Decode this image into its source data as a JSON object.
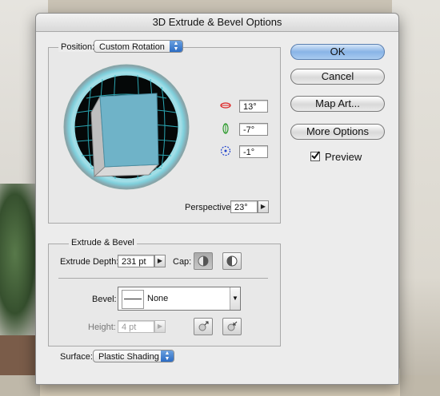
{
  "window": {
    "title": "3D Extrude & Bevel Options"
  },
  "position": {
    "label": "Position:",
    "preset": "Custom Rotation",
    "x_rotation": "13°",
    "y_rotation": "-7°",
    "z_rotation": "-1°",
    "perspective_label": "Perspective:",
    "perspective_value": "23°"
  },
  "extrude_bevel": {
    "group_label": "Extrude & Bevel",
    "depth_label": "Extrude Depth:",
    "depth_value": "231 pt",
    "cap_label": "Cap:",
    "bevel_label": "Bevel:",
    "bevel_value": "None",
    "height_label": "Height:",
    "height_value": "4 pt"
  },
  "surface": {
    "label": "Surface:",
    "value": "Plastic Shading"
  },
  "buttons": {
    "ok": "OK",
    "cancel": "Cancel",
    "map_art": "Map Art...",
    "more_options": "More Options"
  },
  "preview": {
    "label": "Preview",
    "checked": true
  },
  "colors": {
    "cube_face": "#6fb3c8",
    "ring": "#7fd0dc",
    "grid": "#2fb7c4",
    "accent": "#2c6cc4"
  },
  "icons": [
    "x-rotation-icon",
    "y-rotation-icon",
    "z-rotation-icon",
    "cap-on-icon",
    "cap-off-icon",
    "bevel-out-icon",
    "bevel-in-icon",
    "checkbox-icon"
  ]
}
